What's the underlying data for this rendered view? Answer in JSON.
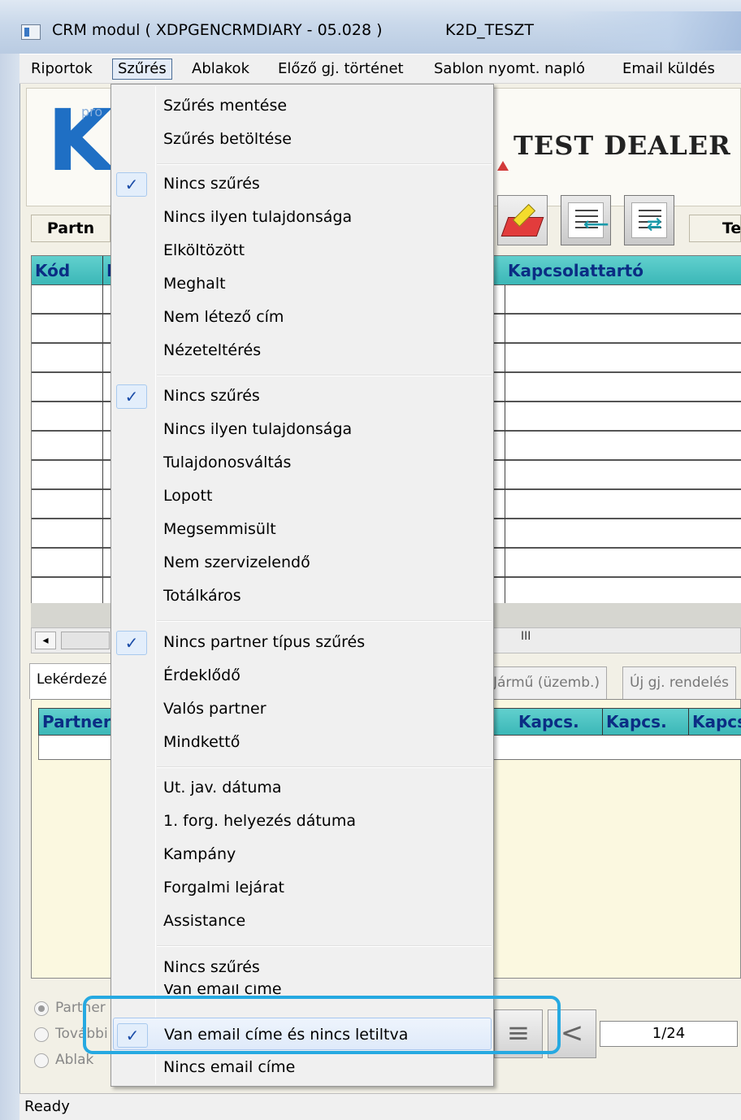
{
  "window": {
    "title": "CRM modul ( XDPGENCRMDIARY - 05.028 )",
    "subtitle": "K2D_TESZT"
  },
  "menubar": {
    "items": [
      "Riportok",
      "Szűrés",
      "Ablakok",
      "Előző gj. történet",
      "Sablon nyomt. napló",
      "Email küldés"
    ]
  },
  "header": {
    "logo_text": "K",
    "logo_small": "pro",
    "dealer_title": "TEST DEALER"
  },
  "toolbar": {
    "partner_label": "Partn",
    "right_label": "Te"
  },
  "grid": {
    "columns": [
      "Kód",
      "N",
      "Kapcsolattartó"
    ]
  },
  "scroll": {
    "left_arrow": "◂",
    "mark": "III"
  },
  "tabs": {
    "items": [
      "Lekérdezé",
      "Jármű (üzemb.)",
      "Új gj. rendelés"
    ]
  },
  "lower": {
    "columns": [
      "Partner",
      "Kapcs.",
      "Kapcs.",
      "Kapcs"
    ]
  },
  "options": {
    "items": [
      "Partner",
      "További",
      "Ablak"
    ]
  },
  "pager": {
    "value": "1/24"
  },
  "status": {
    "text": "Ready"
  },
  "dropdown": {
    "check_glyph": "✓",
    "groups": [
      [
        "Szűrés mentése",
        "Szűrés betöltése"
      ],
      [
        "Nincs szűrés",
        "Nincs ilyen tulajdonsága",
        "Elköltözött",
        "Meghalt",
        "Nem létező cím",
        "Nézeteltérés"
      ],
      [
        "Nincs szűrés",
        "Nincs ilyen tulajdonsága",
        "Tulajdonosváltás",
        "Lopott",
        "Megsemmisült",
        "Nem szervizelendő",
        "Totálkáros"
      ],
      [
        "Nincs partner típus szűrés",
        "Érdeklődő",
        "Valós partner",
        "Mindkettő"
      ],
      [
        "Ut. jav. dátuma",
        "1. forg. helyezés dátuma",
        "Kampány",
        "Forgalmi lejárat",
        "Assistance"
      ],
      [
        "Nincs szűrés",
        "Van email címe",
        "Van email címe és nincs letiltva",
        "Nincs email címe"
      ]
    ]
  },
  "colors": {
    "accent": "#26a9e1",
    "grid_header": "#3bb7b7",
    "grid_header_text": "#0b2d84"
  }
}
